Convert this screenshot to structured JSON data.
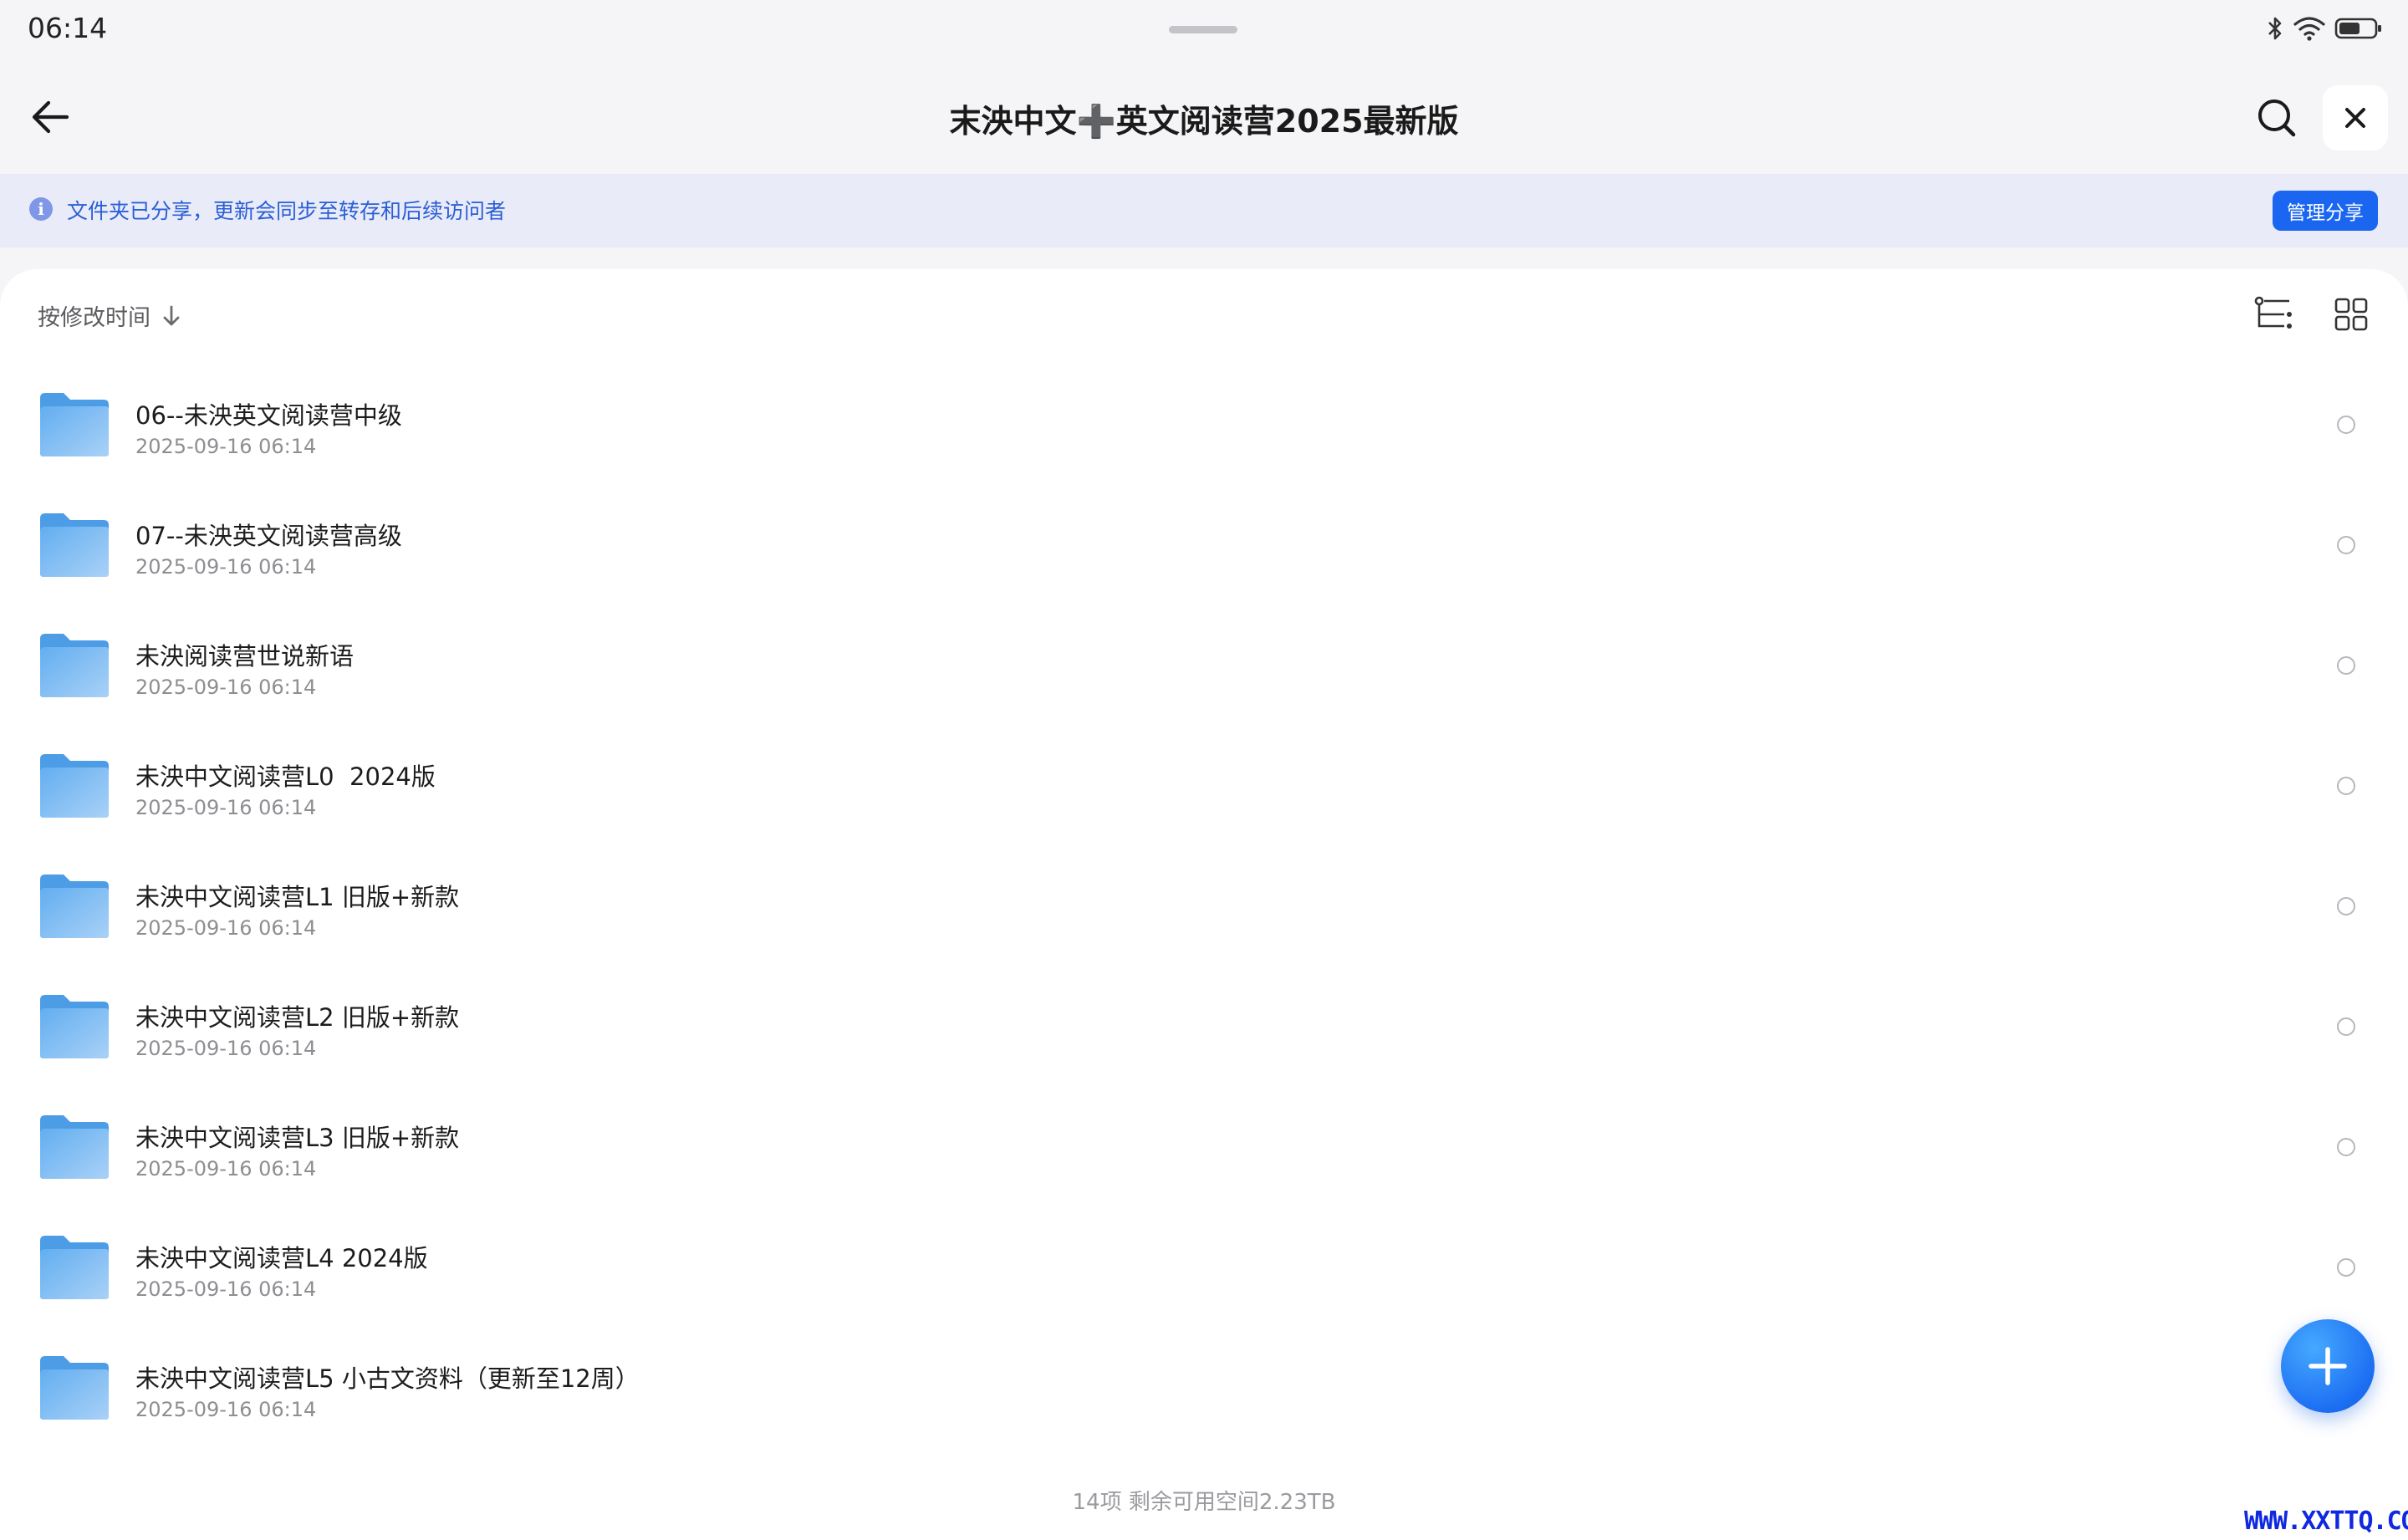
{
  "status_bar": {
    "time": "06:14"
  },
  "header": {
    "title": "末泱中文➕英文阅读营2025最新版"
  },
  "banner": {
    "text": "文件夹已分享，更新会同步至转存和后续访问者",
    "manage_label": "管理分享"
  },
  "toolbar": {
    "sort_label": "按修改时间"
  },
  "files": [
    {
      "name": "06--未泱英文阅读营中级",
      "date": "2025-09-16 06:14"
    },
    {
      "name": "07--未泱英文阅读营高级",
      "date": "2025-09-16 06:14"
    },
    {
      "name": "未泱阅读营世说新语",
      "date": "2025-09-16 06:14"
    },
    {
      "name": "未泱中文阅读营L0  2024版",
      "date": "2025-09-16 06:14"
    },
    {
      "name": "未泱中文阅读营L1 旧版+新款",
      "date": "2025-09-16 06:14"
    },
    {
      "name": "未泱中文阅读营L2 旧版+新款",
      "date": "2025-09-16 06:14"
    },
    {
      "name": "未泱中文阅读营L3 旧版+新款",
      "date": "2025-09-16 06:14"
    },
    {
      "name": "未泱中文阅读营L4 2024版",
      "date": "2025-09-16 06:14"
    },
    {
      "name": "未泱中文阅读营L5 小古文资料（更新至12周）",
      "date": "2025-09-16 06:14"
    }
  ],
  "footer": {
    "summary": "14项 剩余可用空间2.23TB"
  },
  "watermark": "WWW.XXTTQ.COM",
  "colors": {
    "accent": "#1b66f0",
    "banner_bg": "#e9ecf8",
    "banner_text": "#2b5fd6",
    "folder": "#5aa9ee"
  }
}
